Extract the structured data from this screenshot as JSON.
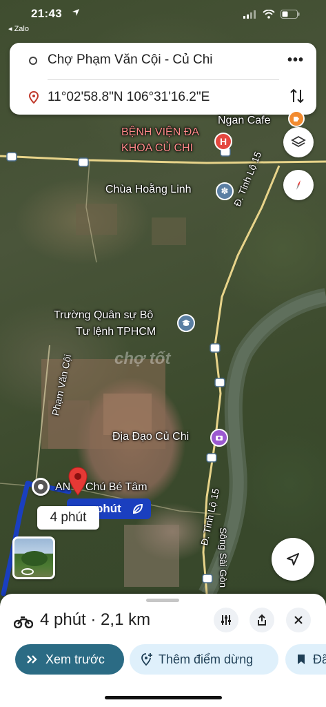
{
  "status_bar": {
    "time": "21:43",
    "back_app": "◂ Zalo"
  },
  "search": {
    "origin": "Chợ Phạm Văn Cội - Củ Chi",
    "destination": "11°02'58.8\"N 106°31'16.2\"E",
    "menu_icon": "more-icon",
    "swap_icon": "swap-vertical-icon"
  },
  "map_labels": {
    "cafe": "Ngan Cafe",
    "hospital_line1": "BỆNH VIỆN ĐA",
    "hospital_line2": "KHOA CỦ CHI",
    "pagoda": "Chùa Hoằng Linh",
    "road_north": "Đ. Tỉnh Lộ 15",
    "school_line1": "Trường Quân sự Bộ",
    "school_line2": "Tư lệnh TPHCM",
    "street_pvc": "Phạm Văn Cội",
    "tunnels": "Địa Đạo Củ Chi",
    "road_south": "Đ. Tỉnh Lộ 15",
    "river": "Sông Sài Gòn",
    "shop": "AN",
    "shop2": "Chú Bé Tâm",
    "watermark": "chợ tốt"
  },
  "route": {
    "chip_text": "phút",
    "time_bubble": "4 phút"
  },
  "sheet": {
    "summary": "4 phút · 2,1 km",
    "preview_button": "Xem trước",
    "add_stop_button": "Thêm điểm dừng",
    "third_button": "Đã"
  },
  "colors": {
    "route": "#1a3fbf",
    "primary_chip": "#2b6b84",
    "secondary_chip": "#dff0fb",
    "pin_red": "#e53935",
    "road": "#e8d48a"
  }
}
